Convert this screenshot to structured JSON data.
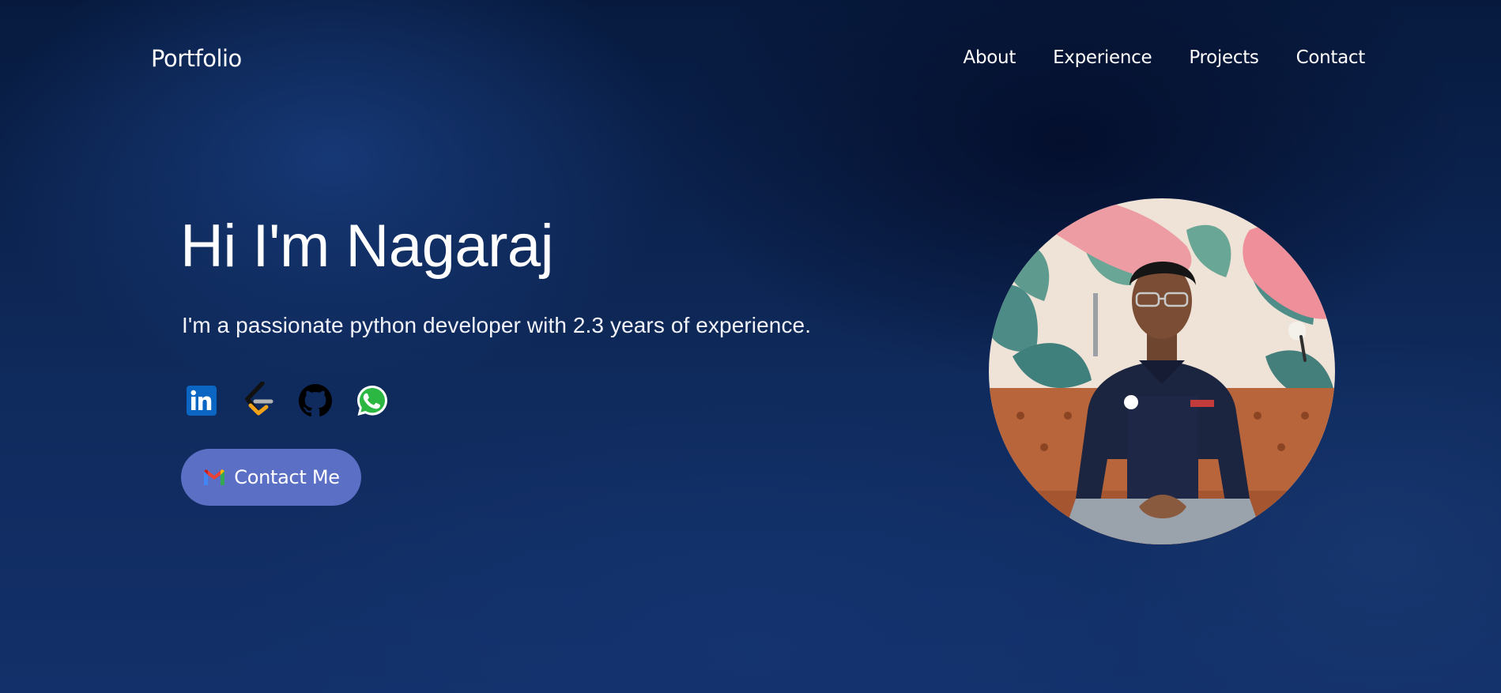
{
  "header": {
    "brand": "Portfolio",
    "nav": [
      {
        "label": "About"
      },
      {
        "label": "Experience"
      },
      {
        "label": "Projects"
      },
      {
        "label": "Contact"
      }
    ]
  },
  "hero": {
    "title": "Hi I'm Nagaraj",
    "subtitle": "I'm a passionate python developer with 2.3 years of experience.",
    "socials": [
      {
        "icon": "linkedin-icon"
      },
      {
        "icon": "leetcode-icon"
      },
      {
        "icon": "github-icon"
      },
      {
        "icon": "whatsapp-icon"
      }
    ],
    "cta": {
      "label": "Contact Me",
      "icon": "gmail-icon"
    }
  },
  "colors": {
    "background": "#0f2a5c",
    "button": "#5b6fc4",
    "text": "#ffffff"
  }
}
